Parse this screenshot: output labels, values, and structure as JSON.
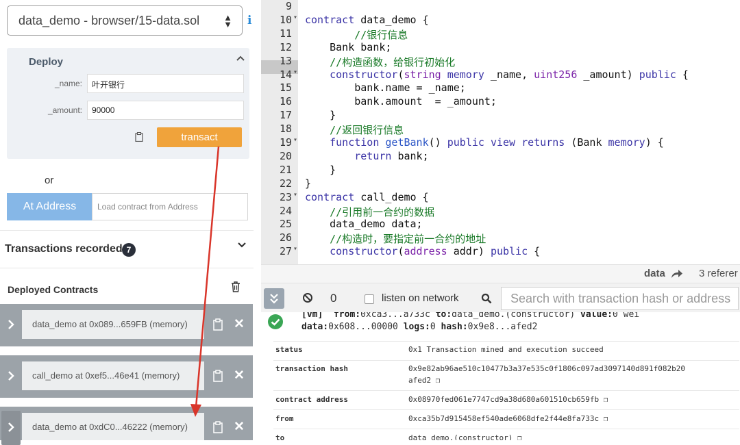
{
  "left_panel": {
    "contract_select": "data_demo - browser/15-data.sol",
    "deploy": {
      "title": "Deploy",
      "params": [
        {
          "label": "_name:",
          "value": "叶开银行"
        },
        {
          "label": "_amount:",
          "value": "90000"
        }
      ],
      "transact_label": "transact"
    },
    "or_label": "or",
    "at_address": {
      "button_label": "At Address",
      "placeholder": "Load contract from Address"
    },
    "transactions": {
      "title": "Transactions recorded:",
      "count": "7"
    },
    "deployed": {
      "title": "Deployed Contracts",
      "items": [
        {
          "label": "data_demo at 0x089...659FB (memory)"
        },
        {
          "label": "call_demo at 0xef5...46e41 (memory)"
        },
        {
          "label": "data_demo at 0xdC0...46222 (memory)"
        }
      ]
    }
  },
  "editor": {
    "lines": [
      {
        "n": "9",
        "fold": "",
        "html": ""
      },
      {
        "n": "10",
        "fold": "▾",
        "html": "<span class='kw'>contract</span> data_demo {"
      },
      {
        "n": "11",
        "fold": "",
        "html": "        <span class='cm'>//银行信息</span>"
      },
      {
        "n": "12",
        "fold": "",
        "html": "    Bank bank;"
      },
      {
        "n": "13",
        "fold": "",
        "html": "    <span class='cm'>//构造函数，给银行初始化</span>"
      },
      {
        "n": "14",
        "fold": "▾",
        "html": "    <span class='kw'>constructor</span>(<span class='ty'>string</span> <span class='kw'>memory</span> _name, <span class='ty'>uint256</span> _amount) <span class='kw'>public</span> {"
      },
      {
        "n": "15",
        "fold": "",
        "html": "        bank.name = _name;"
      },
      {
        "n": "16",
        "fold": "",
        "html": "        bank.amount  = _amount;"
      },
      {
        "n": "17",
        "fold": "",
        "html": "    }"
      },
      {
        "n": "18",
        "fold": "",
        "html": "    <span class='cm'>//返回银行信息</span>"
      },
      {
        "n": "19",
        "fold": "▾",
        "html": "    <span class='kw'>function</span> <span class='fn'>getBank</span>() <span class='kw'>public</span> <span class='kw'>view</span> <span class='kw'>returns</span> (Bank <span class='kw'>memory</span>) {"
      },
      {
        "n": "20",
        "fold": "",
        "html": "        <span class='kw'>return</span> bank;"
      },
      {
        "n": "21",
        "fold": "",
        "html": "    }"
      },
      {
        "n": "22",
        "fold": "",
        "html": "}"
      },
      {
        "n": "23",
        "fold": "▾",
        "html": "<span class='kw'>contract</span> call_demo {"
      },
      {
        "n": "24",
        "fold": "",
        "html": "    <span class='cm'>//引用前一合约的数据</span>"
      },
      {
        "n": "25",
        "fold": "",
        "html": "    data_demo data;"
      },
      {
        "n": "26",
        "fold": "",
        "html": "    <span class='cm'>//构造时，要指定前一合约的地址</span>"
      },
      {
        "n": "27",
        "fold": "▾",
        "html": "    <span class='kw'>constructor</span>(<span class='ty'>address</span> addr) <span class='kw'>public</span> {"
      }
    ],
    "status_word": "data",
    "status_refs": "3 referer"
  },
  "terminal": {
    "count": "0",
    "listen_label": "listen on network",
    "search_placeholder": "Search with transaction hash or address",
    "log_line1_a": "[vm]",
    "log_line1_b": "from:",
    "log_line1_c": "0xca3...a733c",
    "log_line1_d": "to:",
    "log_line1_e": "data_demo.(constructor)",
    "log_line1_f": "value:",
    "log_line1_g": "0 wei",
    "log_line2_a": "data:",
    "log_line2_b": "0x608...00000",
    "log_line2_c": "logs:",
    "log_line2_d": "0",
    "log_line2_e": "hash:",
    "log_line2_f": "0x9e8...afed2",
    "rows": [
      {
        "key": "status",
        "value": "0x1 Transaction mined and execution succeed"
      },
      {
        "key": "transaction hash",
        "value": "0x9e82ab96ae510c10477b3a37e535c0f1806c097ad3097140d891f082b20",
        "value2": "afed2"
      },
      {
        "key": "contract address",
        "value": "0x08970fed061e7747cd9a38d680a601510cb659fb"
      },
      {
        "key": "from",
        "value": "0xca35b7d915458ef540ade6068dfe2f44e8fa733c"
      },
      {
        "key": "to",
        "value": "data_demo.(constructor)"
      }
    ]
  },
  "colors": {
    "transact": "#f0a33b",
    "at_address": "#86b7e7",
    "annotation_arrow": "#d9352a",
    "success": "#3aa655"
  }
}
